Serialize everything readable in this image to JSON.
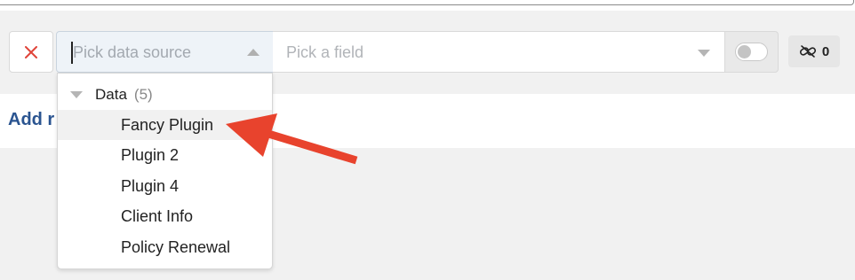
{
  "filter_row": {
    "remove_icon": "close-icon",
    "remove_color": "#e0443a",
    "data_source": {
      "value": "",
      "placeholder": "Pick data source"
    },
    "field": {
      "value": "",
      "placeholder": "Pick a field"
    },
    "toggle_on": false,
    "link_icon": "unlink-icon",
    "link_count": "0"
  },
  "add_link_label": "Add r",
  "dropdown": {
    "group_label": "Data",
    "group_count": "(5)",
    "options": [
      "Fancy Plugin",
      "Plugin 2",
      "Plugin 4",
      "Client Info",
      "Policy Renewal"
    ],
    "highlighted": "Fancy Plugin"
  },
  "annotation": {
    "type": "red-arrow",
    "color": "#e8432d",
    "points_to": "Fancy Plugin"
  }
}
